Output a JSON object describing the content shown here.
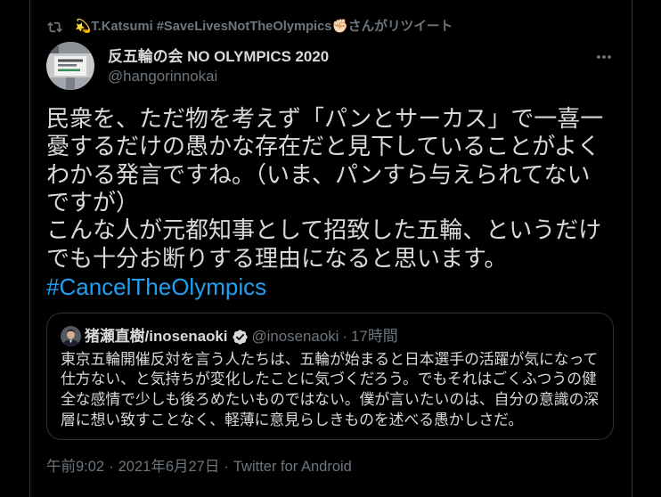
{
  "theme": {
    "background": "#000000",
    "text": "#d9d9d9",
    "secondary_text": "#6e767d",
    "link": "#1da1f2",
    "border": "#2f3336",
    "verified_badge": "#d9d9d9"
  },
  "retweet_context": {
    "icon": "retweet-icon",
    "retweeter_name": "💫T.Katsumi #SaveLivesNotTheOlympics✊🏻",
    "label": "さんがリツイート"
  },
  "tweet": {
    "author": {
      "name": "反五輪の会 NO OLYMPICS 2020",
      "handle": "@hangorinnokai"
    },
    "more_icon": "more-icon",
    "text_lines": [
      "民衆を、ただ物を考えず「パンとサーカス」で一喜一",
      "憂するだけの愚かな存在だと見下していることがよく",
      "わかる発言ですね。（いま、パンすら与えられてない",
      "ですが）",
      "こんな人が元都知事として招致した五輪、というだけ",
      "でも十分お断りする理由になると思います。"
    ],
    "hashtag": "#CancelTheOlympics",
    "quoted_tweet": {
      "author": {
        "name": "猪瀬直樹/inosenaoki",
        "verified_icon": "verified-badge-icon",
        "handle": "@inosenaoki",
        "separator": "·",
        "time": "17時間"
      },
      "text_lines": [
        "東京五輪開催反対を言う人たちは、五輪が始まると日本選手の活躍が気になって",
        "仕方ない、と気持ちが変化したことに気づくだろう。でもそれはごくふつうの健",
        "全な感情で少しも後ろめたいものではない。僕が言いたいのは、自分の意識の深",
        "層に想い致すことなく、軽薄に意見らしきものを述べる愚かしさだ。"
      ]
    },
    "meta": {
      "time": "午前9:02",
      "separator": "·",
      "date": "2021年6月27日",
      "source": "Twitter for Android"
    }
  }
}
